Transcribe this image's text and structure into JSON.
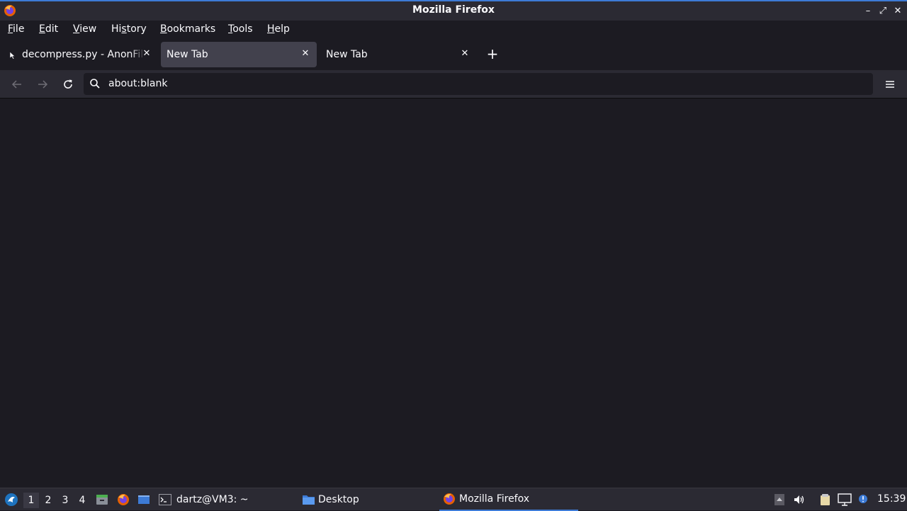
{
  "window": {
    "title": "Mozilla Firefox",
    "controls": [
      "minimize",
      "maximize",
      "close"
    ],
    "minimize_glyph": "–",
    "maximize_glyph": "⤢",
    "close_glyph": "✕"
  },
  "menu": {
    "file": {
      "underline": "F",
      "rest": "ile"
    },
    "edit": {
      "underline": "E",
      "rest": "dit"
    },
    "view": {
      "underline": "V",
      "rest": "iew"
    },
    "history": {
      "pre": "Hi",
      "underline": "s",
      "rest": "tory"
    },
    "bookmarks": {
      "underline": "B",
      "rest": "ookmarks"
    },
    "tools": {
      "underline": "T",
      "rest": "ools"
    },
    "help": {
      "underline": "H",
      "rest": "elp"
    }
  },
  "tabs": [
    {
      "label": "decompress.py - AnonFiles",
      "selected": false,
      "close": "✕"
    },
    {
      "label": "New Tab",
      "selected": true,
      "close": "✕"
    },
    {
      "label": "New Tab",
      "selected": false,
      "close": "✕"
    }
  ],
  "new_tab_glyph": "+",
  "navbar": {
    "url": "about:blank"
  },
  "taskbar": {
    "workspaces": [
      "1",
      "2",
      "3",
      "4"
    ],
    "active_workspace": "1",
    "tasks": [
      {
        "label": "dartz@VM3: ~",
        "icon": "terminal-icon"
      },
      {
        "label": "Desktop",
        "icon": "folder-icon"
      },
      {
        "label": "Mozilla Firefox",
        "icon": "firefox-icon",
        "active": true
      }
    ],
    "clock": "15:39"
  },
  "colors": {
    "accent": "#3d7bd6",
    "background": "#1c1b22",
    "toolbar": "#2b2a33",
    "selected_tab": "#42414d"
  }
}
